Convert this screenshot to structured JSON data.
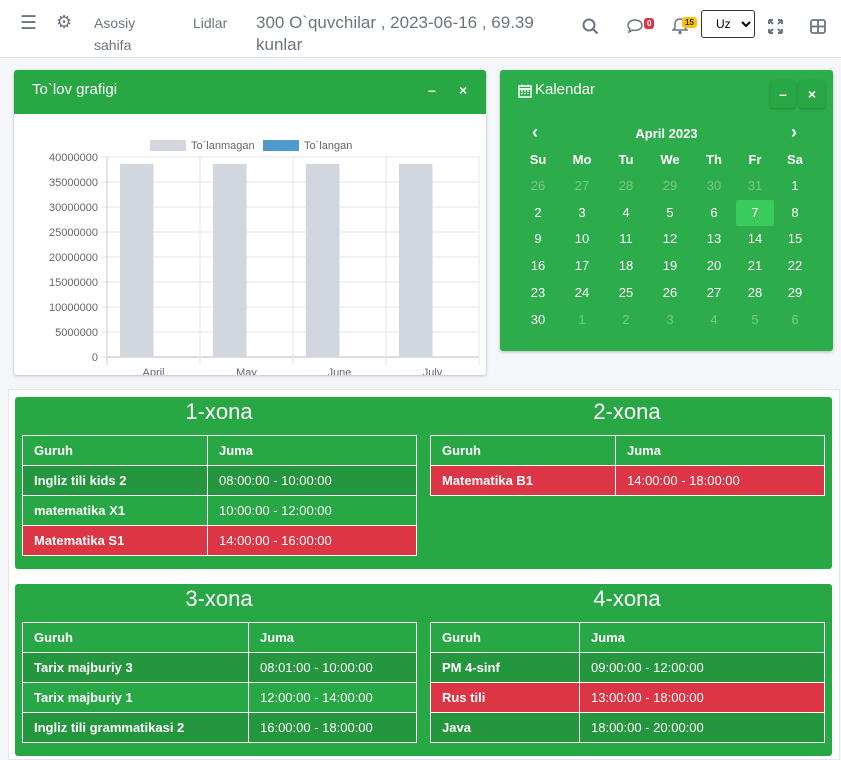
{
  "header": {
    "nav_home": "Asosiy sahifa",
    "nav_leads": "Lidlar",
    "info": "300 O`quvchilar , 2023-06-16 , 69.39 kunlar",
    "messages_badge": "0",
    "notifications_badge": "15",
    "language": "Uz",
    "language_options": [
      "Uz"
    ]
  },
  "chart_card": {
    "title": "To`lov grafigi",
    "minimize": "–",
    "close": "×"
  },
  "chart_data": {
    "type": "bar",
    "categories": [
      "April",
      "May",
      "June",
      "July"
    ],
    "series": [
      {
        "name": "To`lanmagan",
        "values": [
          38600000,
          38600000,
          38600000,
          38600000
        ],
        "color": "#d2d6de"
      },
      {
        "name": "To`langan",
        "values": [
          0,
          0,
          0,
          0
        ],
        "color": "#4f9acb"
      }
    ],
    "ylim": [
      0,
      40000000
    ],
    "yticks": [
      "40000000",
      "35000000",
      "30000000",
      "25000000",
      "20000000",
      "15000000",
      "10000000",
      "5000000",
      "0"
    ],
    "grid": true,
    "legend": "top"
  },
  "calendar": {
    "title": "Kalendar",
    "minimize": "–",
    "close": "×",
    "month": "April 2023",
    "prev": "‹",
    "next": "›",
    "dow": [
      "Su",
      "Mo",
      "Tu",
      "We",
      "Th",
      "Fr",
      "Sa"
    ],
    "weeks": [
      [
        "26",
        "27",
        "28",
        "29",
        "30",
        "31",
        "1"
      ],
      [
        "2",
        "3",
        "4",
        "5",
        "6",
        "7",
        "8"
      ],
      [
        "9",
        "10",
        "11",
        "12",
        "13",
        "14",
        "15"
      ],
      [
        "16",
        "17",
        "18",
        "19",
        "20",
        "21",
        "22"
      ],
      [
        "23",
        "24",
        "25",
        "26",
        "27",
        "28",
        "29"
      ],
      [
        "30",
        "1",
        "2",
        "3",
        "4",
        "5",
        "6"
      ]
    ]
  },
  "rooms": [
    {
      "title": "1-xona",
      "col_group": "Guruh",
      "col_time": "Juma",
      "rows": [
        {
          "group": "Ingliz tili kids 2",
          "time": "08:00:00 - 10:00:00"
        },
        {
          "group": "matematika X1",
          "time": "10:00:00 - 12:00:00"
        },
        {
          "group": "Matematika S1",
          "time": "14:00:00 - 16:00:00"
        }
      ]
    },
    {
      "title": "2-xona",
      "col_group": "Guruh",
      "col_time": "Juma",
      "rows": [
        {
          "group": "Matematika B1",
          "time": "14:00:00 - 18:00:00"
        }
      ]
    },
    {
      "title": "3-xona",
      "col_group": "Guruh",
      "col_time": "Juma",
      "rows": [
        {
          "group": "Tarix majburiy 3",
          "time": "08:01:00 - 10:00:00"
        },
        {
          "group": "Tarix majburiy 1",
          "time": "12:00:00 - 14:00:00"
        },
        {
          "group": "Ingliz tili grammatikasi 2",
          "time": "16:00:00 - 18:00:00"
        }
      ]
    },
    {
      "title": "4-xona",
      "col_group": "Guruh",
      "col_time": "Juma",
      "rows": [
        {
          "group": "PM 4-sinf",
          "time": "09:00:00 - 12:00:00"
        },
        {
          "group": "Rus tili",
          "time": "13:00:00 - 18:00:00"
        },
        {
          "group": "Java",
          "time": "18:00:00 - 20:00:00"
        }
      ]
    }
  ]
}
